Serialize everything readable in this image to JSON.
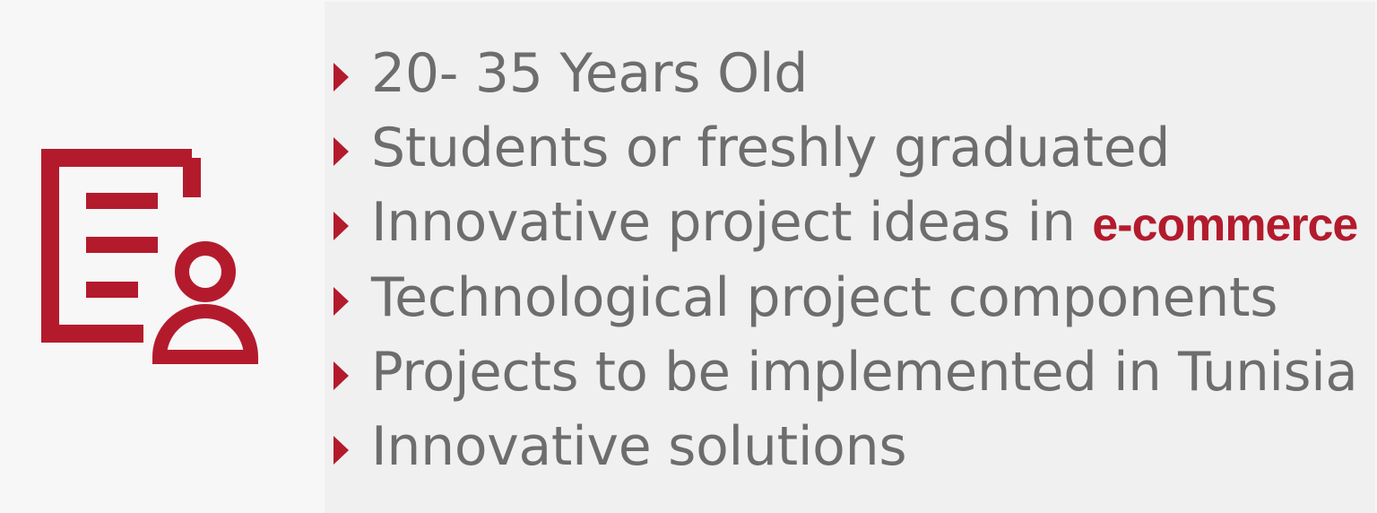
{
  "icon": {
    "name": "document-user-icon",
    "color": "#b31b2d"
  },
  "criteria": {
    "items": [
      {
        "text": "20- 35 Years Old"
      },
      {
        "text": "Students or freshly graduated"
      },
      {
        "text": "Innovative project ideas in ",
        "highlight": "e-commerce"
      },
      {
        "text": "Technological project components"
      },
      {
        "text": "Projects to be implemented in Tunisia"
      },
      {
        "text": "Innovative solutions"
      }
    ]
  },
  "colors": {
    "accent": "#b31b2d",
    "text": "#6d6d6d",
    "panel": "#f0f0f0",
    "background": "#f7f7f7"
  }
}
